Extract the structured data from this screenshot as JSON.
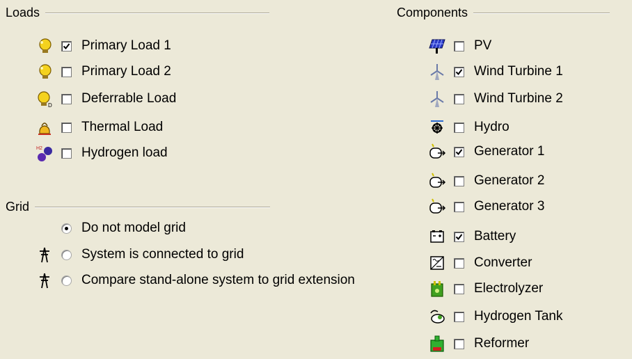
{
  "loads": {
    "title": "Loads",
    "items": [
      {
        "label": "Primary Load 1",
        "checked": true,
        "icon": "primary-load-bulb-icon"
      },
      {
        "label": "Primary Load 2",
        "checked": false,
        "icon": "primary-load-bulb-icon"
      },
      {
        "label": "Deferrable Load",
        "checked": false,
        "icon": "deferrable-load-bulb-icon"
      },
      {
        "label": "Thermal Load",
        "checked": false,
        "icon": "thermal-load-kettle-icon"
      },
      {
        "label": "Hydrogen load",
        "checked": false,
        "icon": "hydrogen-molecule-icon"
      }
    ]
  },
  "grid": {
    "title": "Grid",
    "options": [
      {
        "label": "Do not model grid",
        "selected": true,
        "icon": ""
      },
      {
        "label": "System is connected to grid",
        "selected": false,
        "icon": "grid-tower-icon"
      },
      {
        "label": "Compare stand-alone system to grid extension",
        "selected": false,
        "icon": "grid-tower-icon"
      }
    ]
  },
  "components": {
    "title": "Components",
    "items": [
      {
        "label": "PV",
        "checked": false,
        "icon": "pv-panel-icon"
      },
      {
        "label": "Wind Turbine 1",
        "checked": true,
        "icon": "wind-turbine-icon"
      },
      {
        "label": "Wind Turbine 2",
        "checked": false,
        "icon": "wind-turbine-icon"
      },
      {
        "label": "Hydro",
        "checked": false,
        "icon": "hydro-turbine-icon"
      },
      {
        "label": "Generator 1",
        "checked": true,
        "icon": "generator-icon"
      },
      {
        "label": "Generator 2",
        "checked": false,
        "icon": "generator-icon"
      },
      {
        "label": "Generator 3",
        "checked": false,
        "icon": "generator-icon"
      },
      {
        "label": "Battery",
        "checked": true,
        "icon": "battery-icon"
      },
      {
        "label": "Converter",
        "checked": false,
        "icon": "converter-icon"
      },
      {
        "label": "Electrolyzer",
        "checked": false,
        "icon": "electrolyzer-icon"
      },
      {
        "label": "Hydrogen Tank",
        "checked": false,
        "icon": "hydrogen-tank-icon"
      },
      {
        "label": "Reformer",
        "checked": false,
        "icon": "reformer-icon"
      }
    ]
  },
  "colors": {
    "panel_bg": "#ece9d8",
    "rule": "#aca899"
  }
}
